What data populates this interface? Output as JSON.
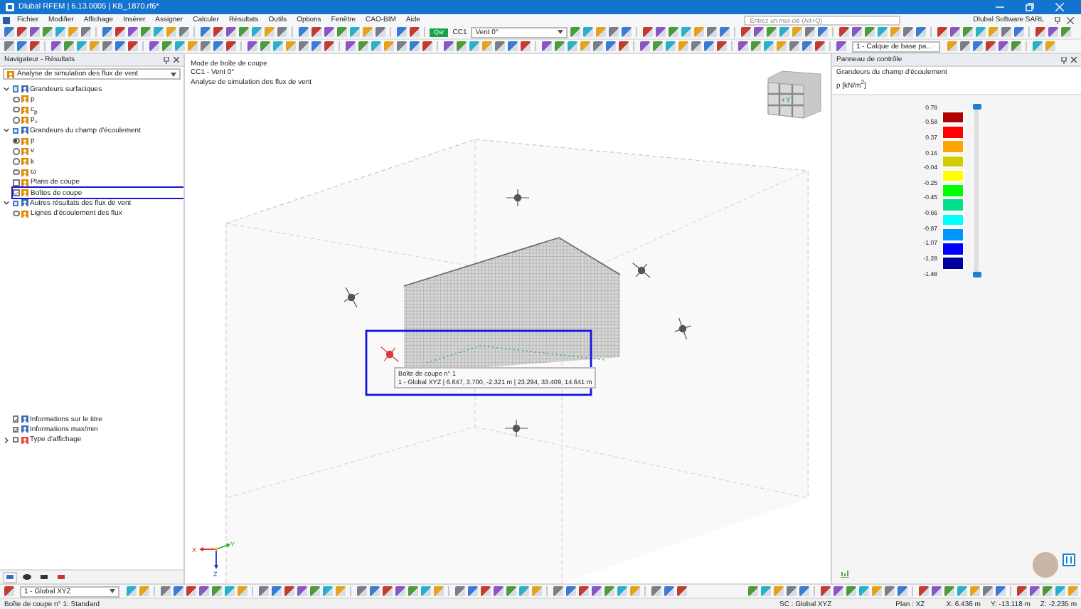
{
  "window": {
    "title": "Dlubal RFEM | 6.13.0005 | KB_1870.rf6*"
  },
  "menu": [
    "Fichier",
    "Modifier",
    "Affichage",
    "Insérer",
    "Assigner",
    "Calculer",
    "Résultats",
    "Outils",
    "Options",
    "Fenêtre",
    "CAO-BIM",
    "Aide"
  ],
  "search": {
    "placeholder": "Entrez un mot-clé (Alt+Q)"
  },
  "account": "Dlubal Software SARL",
  "toolbar": {
    "load_case_badge": "Qsr",
    "load_case": "CC1",
    "load_case_name": "Vent 0°",
    "layer": "1 - Calque de base pa..."
  },
  "navigator": {
    "title": "Navigateur - Résultats",
    "analysis": "Analyse de simulation des flux de vent",
    "tree": [
      {
        "label": "Grandeurs surfaciques",
        "kind": "checkbox",
        "checked": false,
        "expanded": true,
        "highlighted": false,
        "children": [
          {
            "label": "p",
            "kind": "radio",
            "checked": false,
            "highlighted": false
          },
          {
            "label": "c$_{p}$",
            "kind": "radio",
            "checked": false,
            "highlighted": false
          },
          {
            "label": "p$_{+}$",
            "kind": "radio",
            "checked": false,
            "highlighted": false
          }
        ]
      },
      {
        "label": "Grandeurs du champ d'écoulement",
        "kind": "checkbox",
        "checked": false,
        "expanded": true,
        "highlighted": false,
        "children": [
          {
            "label": "p",
            "kind": "radio",
            "checked": true,
            "highlighted": false
          },
          {
            "label": "v",
            "kind": "radio",
            "checked": false,
            "highlighted": false
          },
          {
            "label": "k",
            "kind": "radio",
            "checked": false,
            "highlighted": false
          },
          {
            "label": "ω",
            "kind": "radio",
            "checked": false,
            "highlighted": false
          },
          {
            "label": "Plans de coupe",
            "kind": "checkbox",
            "checked": false,
            "highlighted": false
          },
          {
            "label": "Boîtes de coupe",
            "kind": "checkbox",
            "checked": true,
            "highlighted": true
          }
        ]
      },
      {
        "label": "Autres résultats des flux de vent",
        "kind": "checkbox",
        "checked": false,
        "expanded": true,
        "highlighted": false,
        "children": [
          {
            "label": "Lignes d'écoulement des flux",
            "kind": "radio",
            "checked": false,
            "highlighted": false
          }
        ]
      }
    ],
    "options": [
      {
        "label": "Informations sur le titre",
        "checked": true
      },
      {
        "label": "Informations max/min",
        "checked": true
      },
      {
        "label": "Type d'affichage",
        "checked": false,
        "children_hidden": true
      }
    ]
  },
  "viewport": {
    "info": [
      "Mode de boîte de coupe",
      "CC1 - Vent 0°",
      "Analyse de simulation des flux de vent"
    ],
    "cube_label": "+Y",
    "tooltip": {
      "title": "Boîte de coupe n° 1",
      "detail": "1 - Global XYZ | 6.647, 3.700, -2.321 m | 23.294, 33.409, 14.641 m"
    },
    "axes": {
      "x": "X",
      "y": "Y",
      "z": "Z"
    }
  },
  "control_panel": {
    "title": "Panneau de contrôle",
    "quantity": "Grandeurs du champ d'écoulement",
    "unit": "p [kN/m$^{2}$]",
    "labels": [
      "0.78",
      "0.58",
      "0.37",
      "0.16",
      "-0.04",
      "-0.25",
      "-0.45",
      "-0.66",
      "-0.87",
      "-1.07",
      "-1.28",
      "-1.48"
    ],
    "bands": [
      {
        "color": "#b00000"
      },
      {
        "color": "#ff0000"
      },
      {
        "color": "#ffa500"
      },
      {
        "color": "#d2cc00"
      },
      {
        "color": "#ffff00"
      },
      {
        "color": "#00ff00"
      },
      {
        "color": "#00e08a"
      },
      {
        "color": "#00ffff"
      },
      {
        "color": "#0096ff"
      },
      {
        "color": "#0000ff"
      },
      {
        "color": "#0000a0"
      }
    ]
  },
  "bottom_toolbar": {
    "coordinate_system": "1 - Global XYZ"
  },
  "status_bar": {
    "message": "Boîte de coupe n° 1: Standard",
    "system": "SC : Global XYZ",
    "plane": "Plan : XZ",
    "x": "X: 6.436 m",
    "y": "Y: -13.118 m",
    "z": "Z: -2.235 m"
  }
}
